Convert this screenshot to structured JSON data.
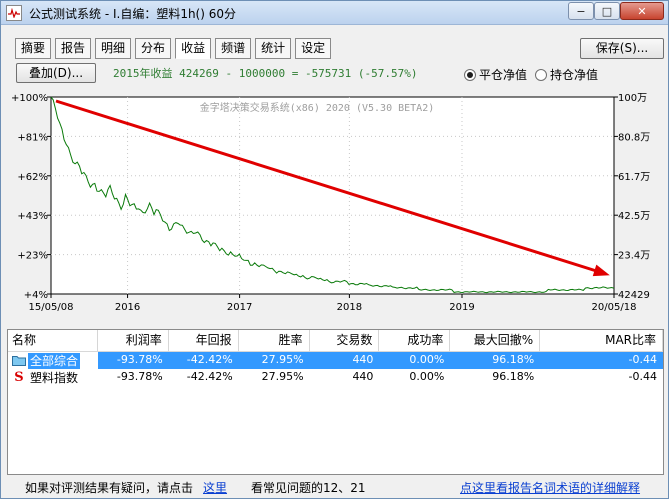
{
  "window": {
    "title": "公式测试系统 - I.自编：塑料1h() 60分",
    "minimize_label": "−",
    "maximize_label": "□",
    "close_label": "✕"
  },
  "tabs": [
    {
      "label": "摘要",
      "active": false
    },
    {
      "label": "报告",
      "active": false
    },
    {
      "label": "明细",
      "active": false
    },
    {
      "label": "分布",
      "active": false
    },
    {
      "label": "收益",
      "active": true
    },
    {
      "label": "频谱",
      "active": false
    },
    {
      "label": "统计",
      "active": false
    },
    {
      "label": "设定",
      "active": false
    }
  ],
  "toolbar": {
    "save_label": "保存(S)...",
    "overlay_label": "叠加(D)...",
    "summary": "2015年收益 424269 - 1000000 = -575731 (-57.57%)",
    "radio_flat": "平仓净值",
    "radio_hold": "持仓净值",
    "selected_radio": "flat"
  },
  "chart_data": {
    "type": "line",
    "watermark": "金字塔决策交易系统(x86) 2020 (V5.30 BETA2)",
    "left_ticks": [
      "+100%",
      "+81%",
      "+62%",
      "+43%",
      "+23%",
      "+4%"
    ],
    "right_ticks": [
      "100万",
      "80.8万",
      "61.7万",
      "42.5万",
      "23.4万",
      "42429"
    ],
    "x_ticks": [
      "15/05/08",
      "2016",
      "2017",
      "2018",
      "2019",
      "20/05/18"
    ],
    "series": [
      {
        "values": [
          100,
          97,
          94,
          90,
          86,
          83,
          80,
          78,
          75,
          72,
          70,
          68,
          67,
          66,
          63,
          62,
          60,
          59,
          57,
          57,
          58,
          56,
          55,
          54,
          53,
          52,
          54,
          55,
          53,
          51,
          50,
          48,
          47,
          49,
          52,
          50,
          48,
          47,
          46,
          45,
          46,
          44,
          43,
          45,
          47,
          48,
          46,
          44,
          45,
          43,
          42,
          40,
          38,
          37,
          36,
          37,
          38,
          39,
          40,
          38,
          36,
          35,
          34,
          33,
          33,
          34,
          35,
          34,
          33,
          32,
          30,
          29,
          29,
          28,
          28,
          27,
          27,
          26,
          26,
          25,
          25,
          24,
          24,
          23,
          23,
          22,
          22,
          21,
          21,
          20,
          20,
          19,
          19,
          19,
          18,
          18,
          18,
          17,
          17,
          17,
          16,
          16,
          16,
          15,
          15,
          15,
          15,
          14,
          14,
          14,
          14,
          13,
          13,
          13,
          13,
          13,
          12,
          12,
          12,
          12,
          12,
          12,
          11,
          11,
          11,
          11,
          11,
          10,
          10,
          10,
          10,
          10,
          10,
          10,
          10,
          10,
          9,
          9,
          9,
          9,
          9,
          9,
          9,
          9,
          9,
          8,
          8,
          8,
          8,
          8,
          8,
          8,
          8,
          8,
          8,
          8,
          7,
          7,
          7,
          7,
          7,
          7,
          7,
          7,
          7,
          7,
          7,
          7,
          6,
          6,
          6,
          6,
          6,
          6,
          6,
          6,
          6,
          6,
          6,
          6,
          6,
          6,
          6,
          6,
          5,
          5,
          5,
          5,
          5,
          5,
          5,
          5,
          5,
          5,
          5,
          5,
          5,
          5,
          5,
          5,
          5,
          5,
          5,
          5,
          5,
          5,
          5,
          5,
          5,
          5,
          5,
          5,
          5,
          5,
          5,
          5,
          5,
          5,
          5,
          5,
          5,
          5,
          5,
          5,
          5,
          5,
          5,
          6,
          6,
          6,
          6,
          6,
          6,
          6,
          6,
          6,
          6,
          6,
          6,
          6,
          6,
          6,
          6,
          6,
          7,
          7,
          7,
          7,
          7,
          7,
          7,
          7,
          7,
          7,
          7,
          7,
          7,
          7
        ]
      }
    ],
    "ylim": [
      4,
      100
    ],
    "line_color": "#0a7a0a",
    "trend_color": "#e00000",
    "grid": true
  },
  "table": {
    "headers": [
      "名称",
      "利润率",
      "年回报",
      "胜率",
      "交易数",
      "成功率",
      "最大回撤%",
      "MAR比率"
    ],
    "rows": [
      {
        "name": "全部综合",
        "icon": "folder-icon",
        "selected": true,
        "cells": [
          "-93.78%",
          "-42.42%",
          "27.95%",
          "440",
          "0.00%",
          "96.18%",
          "-0.44"
        ]
      },
      {
        "name": "塑料指数",
        "icon": "s-icon",
        "icon_text": "S",
        "selected": false,
        "cells": [
          "-93.78%",
          "-42.42%",
          "27.95%",
          "440",
          "0.00%",
          "96.18%",
          "-0.44"
        ]
      }
    ]
  },
  "footer": {
    "question_text": "如果对评测结果有疑问，请点击",
    "here_link": "这里",
    "faq_text": "看常见问题的12、21",
    "glossary_link": "点这里看报告名词术语的详细解释"
  }
}
